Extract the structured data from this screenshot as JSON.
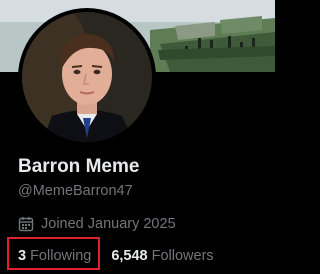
{
  "profile": {
    "display_name": "Barron Meme",
    "handle": "@MemeBarron47",
    "joined": "Joined January 2025",
    "following_count": "3",
    "following_label": "Following",
    "followers_count": "6,548",
    "followers_label": "Followers"
  },
  "icons": {
    "joined": "calendar-icon"
  },
  "colors": {
    "background": "#000000",
    "primary_text": "#e7e9ea",
    "secondary_text": "#71767b",
    "highlight_box": "#e0202a"
  }
}
